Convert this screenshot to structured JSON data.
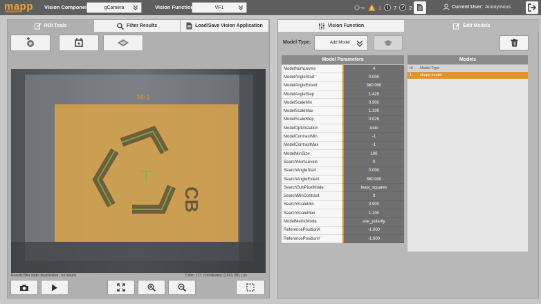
{
  "app": {
    "logo": "mapp"
  },
  "topbar": {
    "vision_component_label": "Vision Component:",
    "vision_component_value": "gCamera",
    "vision_function_label": "Vision Function:",
    "vision_function_value": "VF1",
    "warning_count": "1",
    "info_count": "7",
    "ok_count": "2",
    "current_user_label": "Current User:",
    "current_user_value": "Anonymous"
  },
  "left": {
    "tabs": [
      {
        "label": "ROI Tools"
      },
      {
        "label": "Filter Results"
      },
      {
        "label": "Load/Save Vision Application"
      }
    ],
    "viewer": {
      "model_label": "M-1"
    },
    "status": {
      "filter_state": "Results filter state: deactivated - no results",
      "color_label": "Color:",
      "color_value": "117,",
      "coords_label": "Coordinates:",
      "coord_x": "(1013,",
      "coord_y": "881",
      "coord_unit": ") px"
    }
  },
  "right": {
    "tabs": [
      {
        "label": "Vision Function"
      },
      {
        "label": "Edit Models"
      }
    ],
    "model_type_label": "Model Type:",
    "model_type_value": "Add Model",
    "params_title": "Model Parameters",
    "models_title": "Models",
    "params": [
      {
        "name": "ModelNumLevels",
        "value": "4"
      },
      {
        "name": "ModelAngleStart",
        "value": "0.000"
      },
      {
        "name": "ModelAngleExtent",
        "value": "360.000"
      },
      {
        "name": "ModelAngleStep",
        "value": "1.425"
      },
      {
        "name": "ModelScaleMin",
        "value": "0.900"
      },
      {
        "name": "ModelScaleMax",
        "value": "1.100"
      },
      {
        "name": "ModelScaleStep",
        "value": "0.025"
      },
      {
        "name": "ModelOptimization",
        "value": "Auto"
      },
      {
        "name": "ModelContrastMin",
        "value": "-1"
      },
      {
        "name": "ModelContrastMax",
        "value": "-1"
      },
      {
        "name": "ModelMinSize",
        "value": "100"
      },
      {
        "name": "SearchNumLevels",
        "value": "0"
      },
      {
        "name": "SearchAngleStart",
        "value": "0.000"
      },
      {
        "name": "SearchAngleExtent",
        "value": "360.000"
      },
      {
        "name": "SearchSubPixelMode",
        "value": "least_squares"
      },
      {
        "name": "SearchMinContrast",
        "value": "3"
      },
      {
        "name": "SearchScaleMin",
        "value": "0.900"
      },
      {
        "name": "SearchScaleMax",
        "value": "1.100"
      },
      {
        "name": "ModelMetricMode",
        "value": "use_polarity"
      },
      {
        "name": "ReferencePositionX",
        "value": "-1.000"
      },
      {
        "name": "ReferencePositionY",
        "value": "-1.000"
      }
    ],
    "models_headers": {
      "id": "Id",
      "type": "Model Type"
    },
    "models": [
      {
        "id": "1",
        "type": "shape model"
      }
    ]
  },
  "colors": {
    "accent": "#e2932e",
    "topbar": "#5e5e5e",
    "roi_fill": "#d9a54a"
  }
}
